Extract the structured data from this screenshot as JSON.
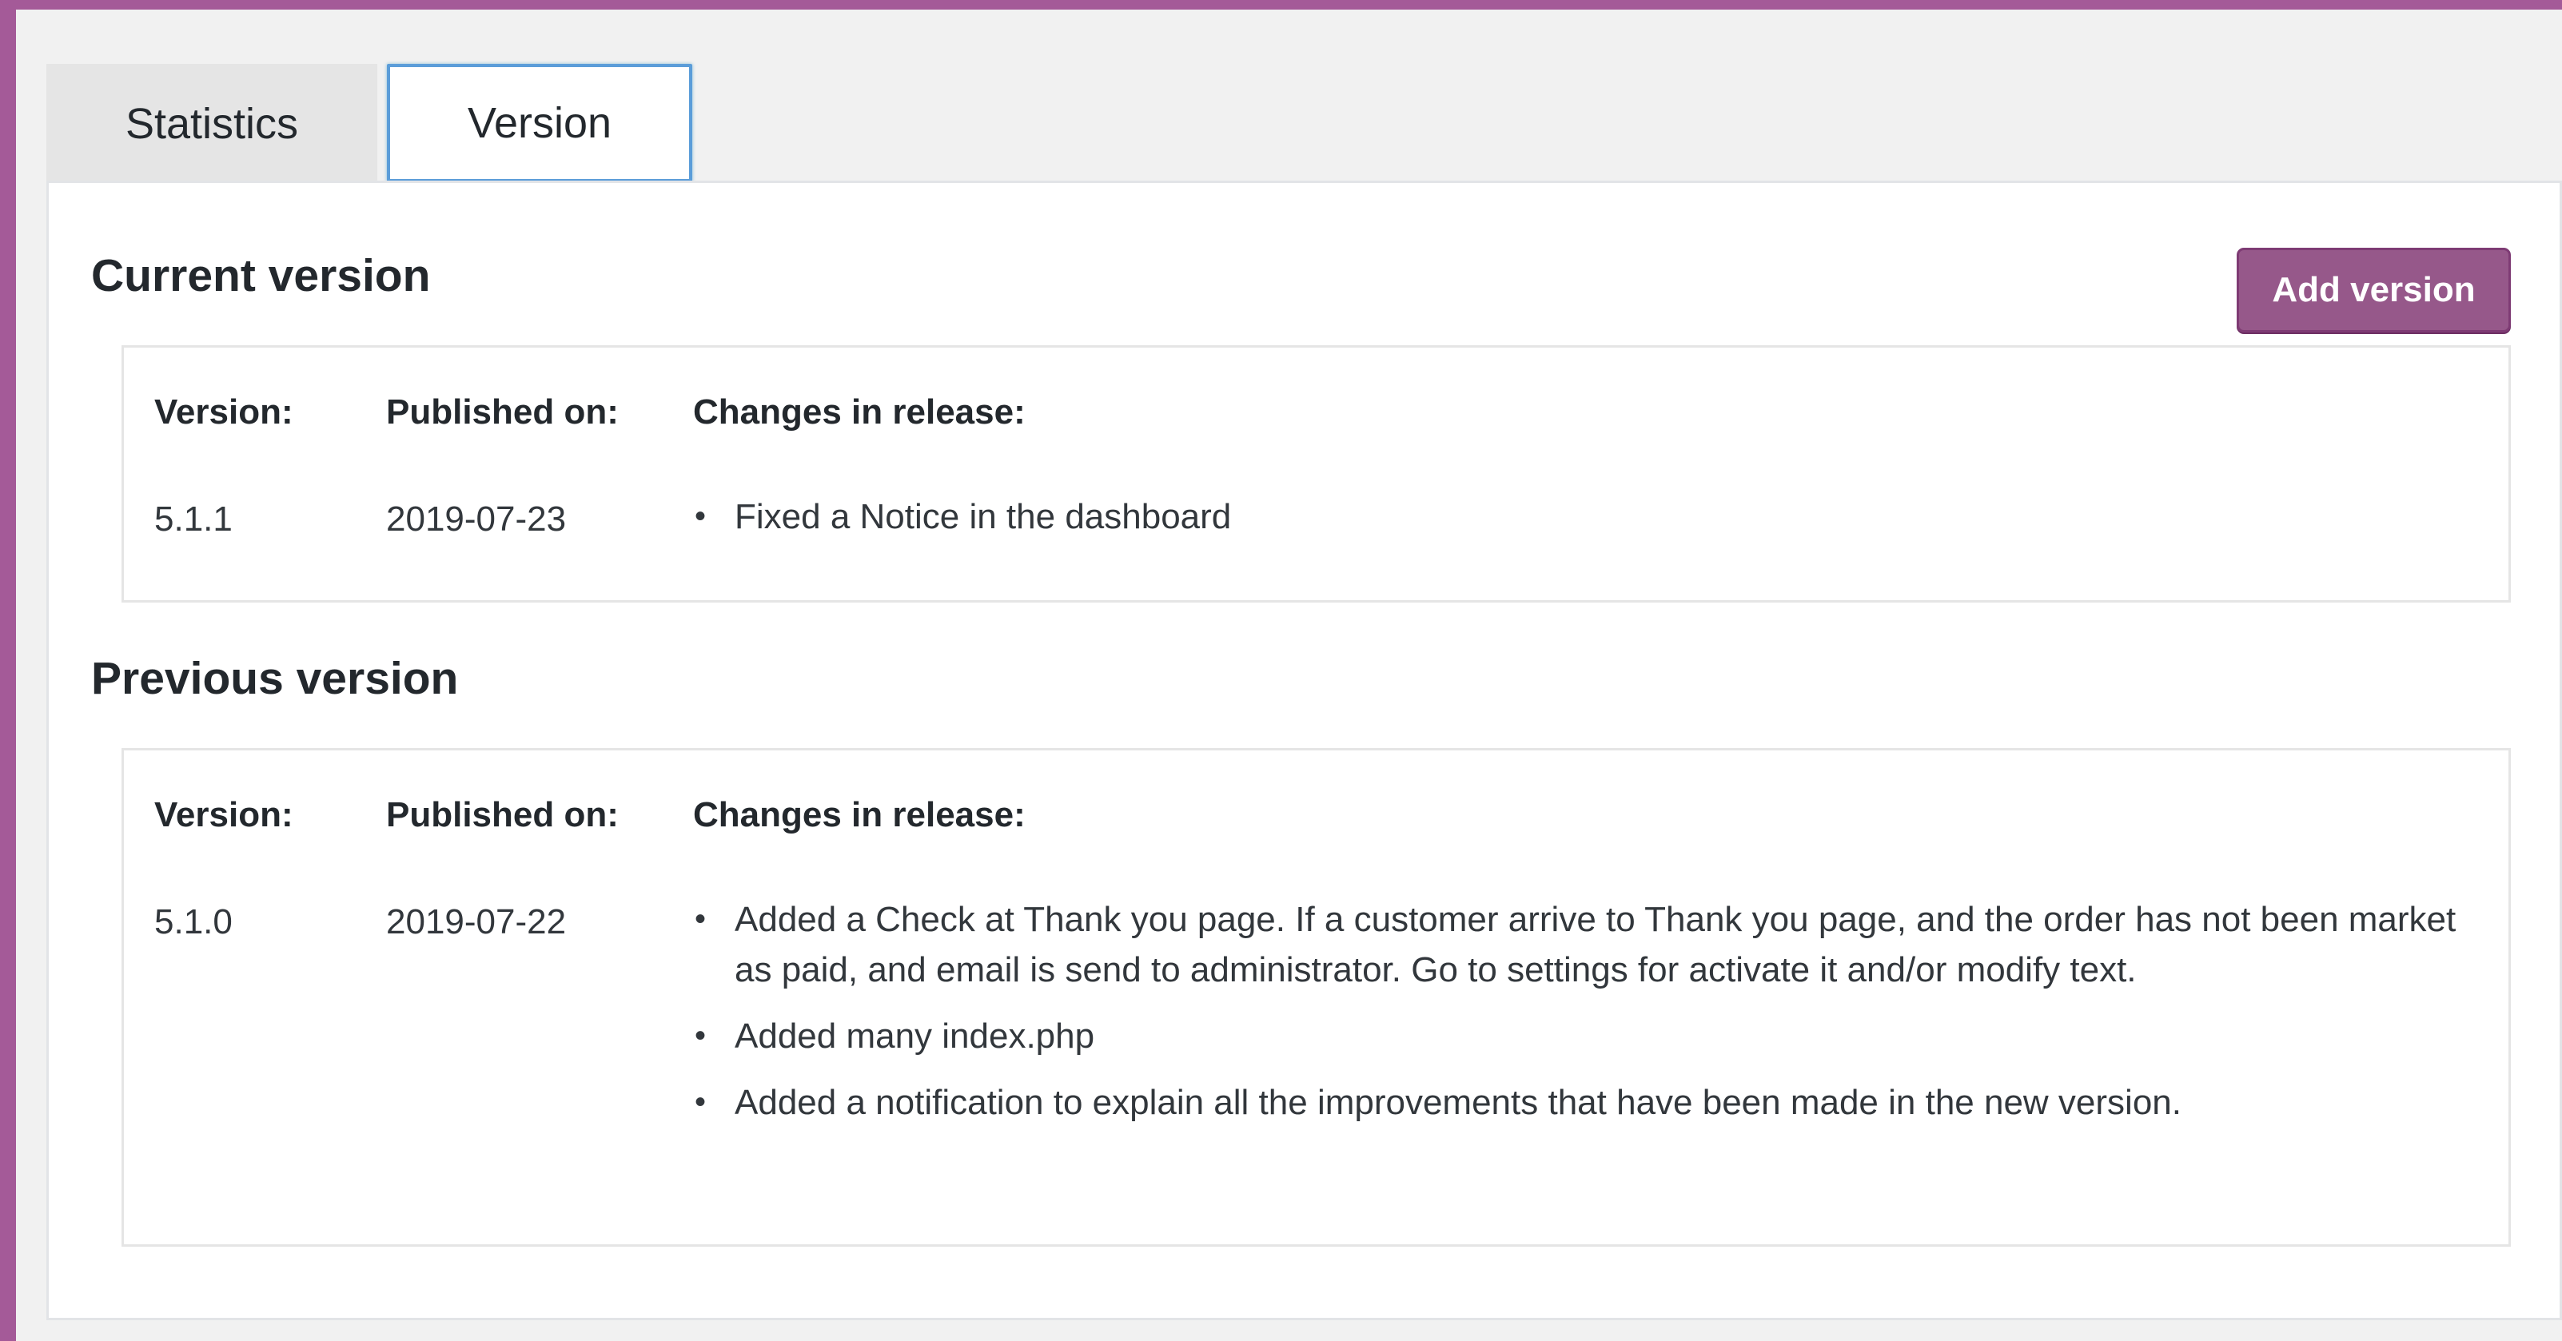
{
  "tabs": [
    {
      "label": "Statistics",
      "active": false
    },
    {
      "label": "Version",
      "active": true
    }
  ],
  "current": {
    "title": "Current version",
    "add_button": "Add version",
    "headers": {
      "version": "Version:",
      "published": "Published on:",
      "changes": "Changes in release:"
    },
    "version": "5.1.1",
    "published": "2019-07-23",
    "changes": [
      "Fixed a Notice in the dashboard"
    ]
  },
  "previous": {
    "title": "Previous version",
    "headers": {
      "version": "Version:",
      "published": "Published on:",
      "changes": "Changes in release:"
    },
    "version": "5.1.0",
    "published": "2019-07-22",
    "changes": [
      "Added a Check at Thank you page. If a customer arrive to Thank you page, and the order has not been market as paid, and email is send to administrator. Go to settings for activate it and/or modify text.",
      "Added many index.php",
      "Added a notification to explain all the improvements that have been made in the new version."
    ]
  },
  "colors": {
    "accent": "#96588a",
    "border_frame": "#a45a98",
    "tab_focus": "#5b9dd9"
  }
}
